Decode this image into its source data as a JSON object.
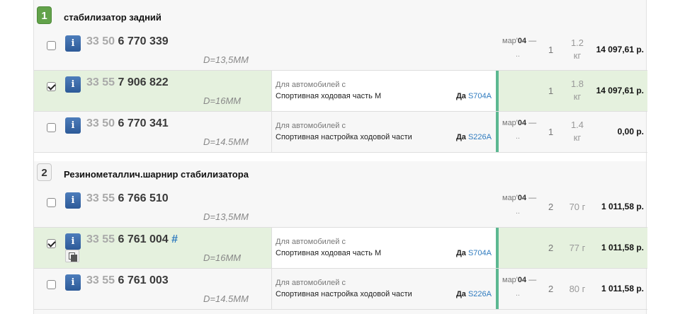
{
  "groups": [
    {
      "number": "1",
      "title": "стабилизатор задний",
      "rows": [
        {
          "checked": false,
          "info_label": "i",
          "prefix": "33 50",
          "main": "6 770 339",
          "dim": "D=13,5MM",
          "note_line1": "",
          "note_line2": "",
          "yes_label": "",
          "code": "",
          "date_label": "мар'",
          "date_year": "04",
          "date_sep": " —",
          "date_end": "..",
          "qty": "1",
          "weight_value": "1.2",
          "weight_unit": "кг",
          "price": "14 097,61 р."
        },
        {
          "checked": true,
          "info_label": "i",
          "prefix": "33 55",
          "main": "7 906 822",
          "dim": "D=16MM",
          "note_line1": "Для автомобилей с",
          "note_line2": "Спортивная ходовая часть M",
          "yes_label": "Да",
          "code": "S704A",
          "date_label": "",
          "date_year": "",
          "date_sep": "",
          "date_end": "",
          "qty": "1",
          "weight_value": "1.8",
          "weight_unit": "кг",
          "price": "14 097,61 р."
        },
        {
          "checked": false,
          "info_label": "i",
          "prefix": "33 50",
          "main": "6 770 341",
          "dim": "D=14.5MM",
          "note_line1": "Для автомобилей с",
          "note_line2": "Спортивная настройка ходовой части",
          "yes_label": "Да",
          "code": "S226A",
          "date_label": "мар'",
          "date_year": "04",
          "date_sep": " —",
          "date_end": "..",
          "qty": "1",
          "weight_value": "1.4",
          "weight_unit": "кг",
          "price": "0,00 р."
        }
      ]
    },
    {
      "number": "2",
      "title": "Резинометаллич.шарнир стабилизатора",
      "rows": [
        {
          "checked": false,
          "info_label": "i",
          "prefix": "33 55",
          "main": "6 766 510",
          "hash": "",
          "dim": "D=13,5MM",
          "note_line1": "",
          "note_line2": "",
          "yes_label": "",
          "code": "",
          "date_label": "мар'",
          "date_year": "04",
          "date_sep": " —",
          "date_end": "..",
          "qty": "2",
          "weight": "70 г",
          "price": "1 011,58 р."
        },
        {
          "checked": true,
          "info_label": "i",
          "prefix": "33 55",
          "main": "6 761 004",
          "hash": "#",
          "dim": "D=16MM",
          "note_line1": "Для автомобилей с",
          "note_line2": "Спортивная ходовая часть M",
          "yes_label": "Да",
          "code": "S704A",
          "date_label": "",
          "date_year": "",
          "date_sep": "",
          "date_end": "",
          "qty": "2",
          "weight": "77 г",
          "price": "1 011,58 р."
        },
        {
          "checked": false,
          "info_label": "i",
          "prefix": "33 55",
          "main": "6 761 003",
          "hash": "",
          "dim": "D=14.5MM",
          "note_line1": "Для автомобилей с",
          "note_line2": "Спортивная настройка ходовой части",
          "yes_label": "Да",
          "code": "S226A",
          "date_label": "мар'",
          "date_year": "04",
          "date_sep": " —",
          "date_end": "..",
          "qty": "2",
          "weight": "80 г",
          "price": "1 011,58 р."
        }
      ]
    }
  ],
  "colors": {
    "accent_green": "#62a24a",
    "selected_row": "#e5f1de",
    "link_blue": "#2f7bbf",
    "info_button": "#3a69a9",
    "status_bar": "#5cb891"
  }
}
